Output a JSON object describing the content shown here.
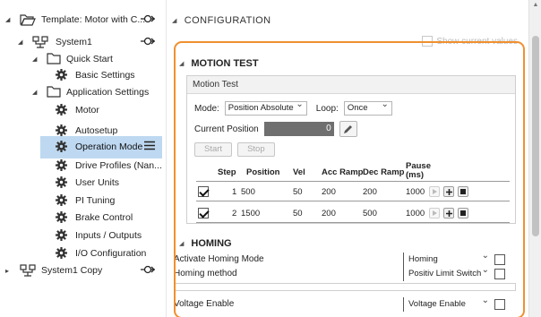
{
  "tree": {
    "items": [
      {
        "label": "Template: Motor with C...",
        "icon": "folder-open-icon",
        "twisty": "expanded"
      },
      {
        "label": "System1",
        "icon": "network-icon",
        "twisty": "expanded"
      },
      {
        "label": "Quick Start",
        "icon": "folder-icon",
        "twisty": "expanded"
      },
      {
        "label": "Basic Settings",
        "icon": "gear-icon"
      },
      {
        "label": "Application Settings",
        "icon": "folder-icon",
        "twisty": "expanded"
      },
      {
        "label": "Motor",
        "icon": "gear-icon"
      },
      {
        "label": "Autosetup",
        "icon": "gear-icon"
      },
      {
        "label": "Operation Mode",
        "icon": "gear-icon",
        "selected": true
      },
      {
        "label": "Drive Profiles (Nan...",
        "icon": "gear-icon"
      },
      {
        "label": "User Units",
        "icon": "gear-icon"
      },
      {
        "label": "PI Tuning",
        "icon": "gear-icon"
      },
      {
        "label": "Brake Control",
        "icon": "gear-icon"
      },
      {
        "label": "Inputs / Outputs",
        "icon": "gear-icon"
      },
      {
        "label": "I/O Configuration",
        "icon": "gear-icon"
      },
      {
        "label": "System1 Copy",
        "icon": "network-icon",
        "twisty": "collapsed"
      }
    ]
  },
  "main": {
    "title": "CONFIGURATION",
    "show_current_values": "Show current values",
    "motion_test": {
      "heading": "MOTION TEST",
      "panel_title": "Motion Test",
      "mode_label": "Mode:",
      "mode_value": "Position Absolute",
      "loop_label": "Loop:",
      "loop_value": "Once",
      "current_position_label": "Current Position",
      "current_position_value": "0",
      "start_label": "Start",
      "stop_label": "Stop",
      "table": {
        "headers": [
          "Step",
          "Position",
          "Vel",
          "Acc Ramp",
          "Dec Ramp",
          "Pause\n(ms)"
        ],
        "rows": [
          {
            "checked": true,
            "step": "1",
            "position": "500",
            "vel": "50",
            "acc": "200",
            "dec": "200",
            "pause": "1000"
          },
          {
            "checked": true,
            "step": "2",
            "position": "1500",
            "vel": "50",
            "acc": "200",
            "dec": "500",
            "pause": "1000"
          }
        ]
      }
    },
    "homing": {
      "heading": "HOMING",
      "rows": [
        {
          "label": "Activate Homing Mode",
          "value": "Homing"
        },
        {
          "label": "Homing method",
          "value": "Positiv Limit Switch"
        },
        {
          "label": "Voltage Enable",
          "value": "Voltage Enable"
        }
      ]
    }
  },
  "colors": {
    "accent_highlight": "#f0902f",
    "selection": "#bed8f1",
    "position_box": "#6f6f6f"
  }
}
